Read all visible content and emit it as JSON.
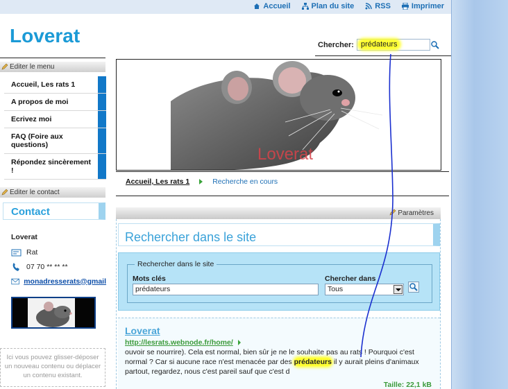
{
  "header": {
    "links": [
      {
        "label": "Accueil",
        "icon": "home-icon"
      },
      {
        "label": "Plan du site",
        "icon": "sitemap-icon"
      },
      {
        "label": "RSS",
        "icon": "rss-icon"
      },
      {
        "label": "Imprimer",
        "icon": "print-icon"
      }
    ],
    "logo": "Loverat",
    "search": {
      "label": "Chercher:",
      "value": "prédateurs"
    }
  },
  "sidebar": {
    "edit_menu_label": "Editer le menu",
    "menu": [
      {
        "label": "Accueil, Les rats 1"
      },
      {
        "label": "A propos de moi"
      },
      {
        "label": "Ecrivez moi"
      },
      {
        "label": "FAQ (Foire aux questions)"
      },
      {
        "label": "Répondez sincèrement !"
      }
    ],
    "edit_contact_label": "Editer le contact",
    "contact": {
      "title": "Contact",
      "name": "Loverat",
      "company": "Rat",
      "phone": "07 70 ** ** **",
      "email": "monadresserats@gmail"
    },
    "dropzone_text": "Ici vous pouvez glisser-déposer un nouveau contenu ou déplacer un contenu existant."
  },
  "banner": {
    "caption": "Loverat"
  },
  "breadcrumb": {
    "home": "Accueil, Les rats 1",
    "current": "Recherche en cours"
  },
  "params_label": "Paramètres",
  "search_page": {
    "title": "Rechercher dans le site",
    "legend": "Rechercher dans le site",
    "keywords_label": "Mots clés",
    "keywords_value": "prédateurs",
    "scope_label": "Chercher dans",
    "scope_value": "Tous"
  },
  "result": {
    "title": "Loverat",
    "url": "http://lesrats.webnode.fr/home/",
    "snippet_before": "ouvoir se nourrire). Cela est normal, bien sûr je ne le souhaite pas au rats ! Pourquoi c'est normal ? Car si aucune race n'est menacée par des ",
    "keyword": "prédateurs",
    "snippet_after": " il y aurait pleins d'animaux partout, regardez, nous c'est pareil sauf que c'est d",
    "size": "Taille: 22,1 kB"
  },
  "colors": {
    "accent": "#1b9ad6",
    "menu_marker": "#1178c8",
    "highlight": "#ffff33",
    "annotation": "#1a2fcf"
  }
}
